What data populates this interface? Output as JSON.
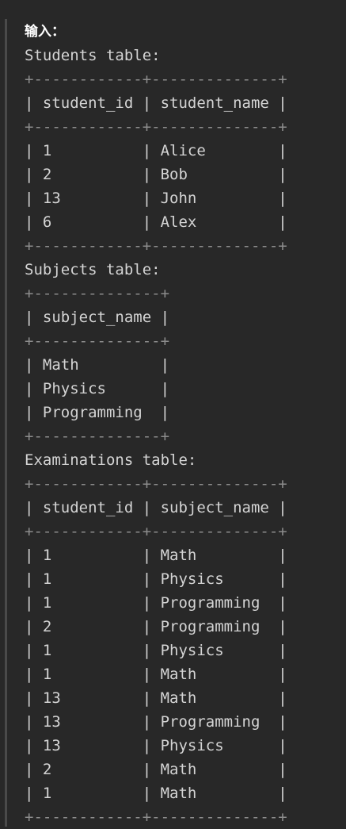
{
  "heading": "输入：",
  "students": {
    "caption": "Students table:",
    "border": "+------------+--------------+",
    "header": "| student_id | student_name |",
    "rows": [
      "| 1          | Alice        |",
      "| 2          | Bob          |",
      "| 13         | John         |",
      "| 6          | Alex         |"
    ]
  },
  "subjects": {
    "caption": "Subjects table:",
    "border": "+--------------+",
    "header": "| subject_name |",
    "rows": [
      "| Math         |",
      "| Physics      |",
      "| Programming  |"
    ]
  },
  "examinations": {
    "caption": "Examinations table:",
    "border": "+------------+--------------+",
    "header": "| student_id | subject_name |",
    "rows": [
      "| 1          | Math         |",
      "| 1          | Physics      |",
      "| 1          | Programming  |",
      "| 2          | Programming  |",
      "| 1          | Physics      |",
      "| 1          | Math         |",
      "| 13         | Math         |",
      "| 13         | Programming  |",
      "| 13         | Physics      |",
      "| 2          | Math         |",
      "| 1          | Math         |"
    ]
  },
  "colors": {
    "background": "#282828",
    "text": "#d4d4d4",
    "border": "#8c8c8c",
    "heading": "#ffffff"
  }
}
